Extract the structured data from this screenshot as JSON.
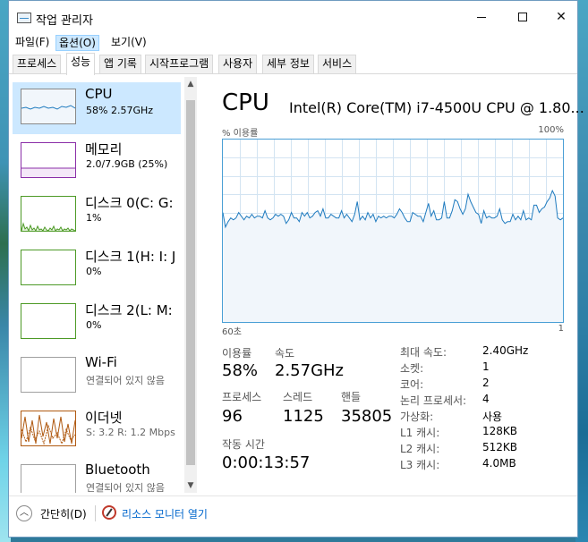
{
  "window": {
    "title": "작업 관리자",
    "close_glyph": "✕"
  },
  "menu": {
    "items": [
      "파일(F)",
      "옵션(O)",
      "보기(V)"
    ]
  },
  "tabs": [
    "프로세스",
    "성능",
    "앱 기록",
    "시작프로그램",
    "사용자",
    "세부 정보",
    "서비스"
  ],
  "sidebar": {
    "items": [
      {
        "name": "CPU",
        "sub": "58% 2.57GHz",
        "color": "#1f7bbf"
      },
      {
        "name": "메모리",
        "sub": "2.0/7.9GB (25%)",
        "color": "#8b2fa8"
      },
      {
        "name": "디스크 0(C: G:",
        "sub": "1%",
        "color": "#4d9a26"
      },
      {
        "name": "디스크 1(H: I: J",
        "sub": "0%",
        "color": "#4d9a26"
      },
      {
        "name": "디스크 2(L: M:",
        "sub": "0%",
        "color": "#4d9a26"
      },
      {
        "name": "Wi-Fi",
        "sub": "연결되어 있지 않음",
        "color": "#a0a0a0"
      },
      {
        "name": "이더넷",
        "sub": "S: 3.2  R: 1.2 Mbps",
        "color": "#b05a12"
      },
      {
        "name": "Bluetooth",
        "sub": "연결되어 있지 않음",
        "color": "#a0a0a0"
      }
    ]
  },
  "detail": {
    "title": "CPU",
    "model": "Intel(R) Core(TM) i7-4500U CPU @ 1.80...",
    "graph_top_left": "% 이용률",
    "graph_top_right": "100%",
    "graph_bottom_left": "60초",
    "graph_bottom_right": "1",
    "stats": {
      "util_label": "이용률",
      "util_value": "58%",
      "speed_label": "속도",
      "speed_value": "2.57GHz",
      "proc_label": "프로세스",
      "proc_value": "96",
      "thread_label": "스레드",
      "thread_value": "1125",
      "handle_label": "핸들",
      "handle_value": "35805",
      "uptime_label": "작동 시간",
      "uptime_value": "0:00:13:57"
    },
    "specs": [
      {
        "label": "최대 속도:",
        "value": "2.40GHz"
      },
      {
        "label": "소켓:",
        "value": "1"
      },
      {
        "label": "코어:",
        "value": "2"
      },
      {
        "label": "논리 프로세서:",
        "value": "4"
      },
      {
        "label": "가상화:",
        "value": "사용"
      },
      {
        "label": "L1 캐시:",
        "value": "128KB"
      },
      {
        "label": "L2 캐시:",
        "value": "512KB"
      },
      {
        "label": "L3 캐시:",
        "value": "4.0MB"
      }
    ]
  },
  "cpu_history": [
    60,
    52,
    55,
    57,
    56,
    57,
    60,
    58,
    56,
    58,
    57,
    59,
    57,
    58,
    58,
    57,
    61,
    57,
    56,
    57,
    59,
    58,
    59,
    58,
    54,
    56,
    60,
    57,
    57,
    55,
    60,
    58,
    60,
    57,
    58,
    60,
    61,
    58,
    62,
    57,
    57,
    59,
    58,
    57,
    57,
    61,
    57,
    59,
    57,
    55,
    59,
    66,
    56,
    58,
    56,
    60,
    57,
    59,
    55,
    58,
    57,
    58,
    57,
    58,
    58,
    57,
    59,
    62,
    60,
    57,
    55,
    55,
    60,
    59,
    58,
    58,
    55,
    60,
    65,
    58,
    61,
    56,
    56,
    57,
    66,
    57,
    57,
    61,
    67,
    66,
    62,
    59,
    62,
    70,
    66,
    63,
    60,
    59,
    54,
    61,
    57,
    58,
    57,
    57,
    58,
    62,
    56,
    54,
    55,
    55,
    59,
    56,
    58,
    56,
    61,
    56,
    57,
    56,
    64,
    64,
    60,
    62,
    63,
    66,
    68,
    72,
    69,
    57,
    56,
    57
  ],
  "bottom": {
    "collapse_label": "간단히(D)",
    "resmon_label": "리소스 모니터 열기"
  },
  "colors": {
    "accent": "#1f7bbf",
    "graph_line": "#1f7bbf",
    "graph_fill": "#f1f6fb",
    "graph_grid": "#d3e4f2",
    "selected_bg": "#cce8ff",
    "link": "#0066cc"
  }
}
